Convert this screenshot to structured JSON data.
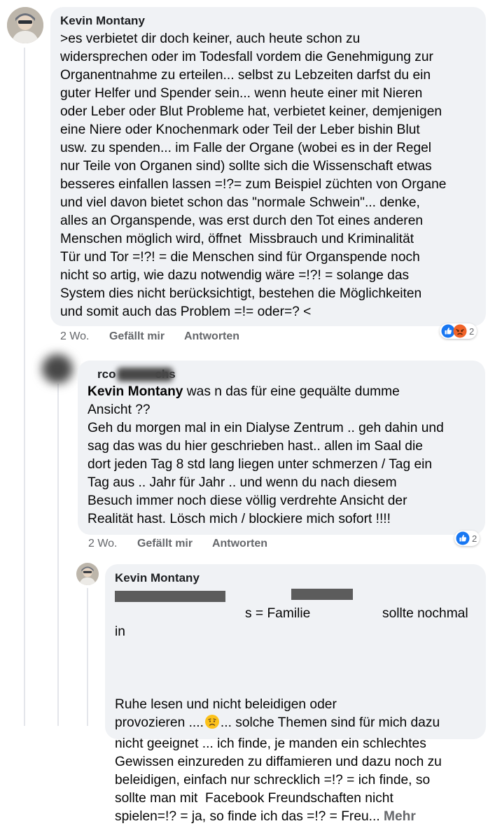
{
  "comment1": {
    "author": "Kevin Montany",
    "lines": [
      ">es verbietet dir doch keiner, auch heute schon zu",
      "widersprechen oder im Todesfall vordem die Genehmigung zur",
      "Organentnahme zu erteilen... selbst zu Lebzeiten darfst du ein",
      "guter Helfer und Spender sein... wenn heute einer mit Nieren",
      "oder Leber oder Blut Probleme hat, verbietet keiner, demjenigen",
      "eine Niere oder Knochenmark oder Teil der Leber bishin Blut",
      "usw. zu spenden... im Falle der Organe (wobei es in der Regel",
      "nur Teile von Organen sind) sollte sich die Wissenschaft etwas",
      "besseres einfallen lassen =!?= zum Beispiel züchten von Organe",
      "und viel davon bietet schon das \"normale Schwein\"... denke,",
      "alles an Organspende, was erst durch den Tot eines anderen",
      "Menschen möglich wird, öffnet  Missbrauch und Kriminalität",
      "Tür und Tor =!?! = die Menschen sind für Organspende noch",
      "nicht so artig, wie dazu notwendig wäre =!?! = solange das",
      "System dies nicht berücksichtigt, bestehen die Möglichkeiten",
      "und somit auch das Problem =!= oder=? <"
    ],
    "time": "2 Wo.",
    "like": "Gefällt mir",
    "reply": "Antworten",
    "reaction_count": "2"
  },
  "comment2": {
    "author_partial": "rco",
    "author_partial2": "chs",
    "mention": "Kevin Montany",
    "first_line_rest": " was n das für eine gequälte dumme",
    "lines": [
      "Ansicht ??",
      "Geh du morgen mal in ein Dialyse Zentrum .. geh dahin und",
      "sag das was du hier geschrieben hast.. allen im Saal die",
      "dort jeden Tag 8 std lang liegen unter schmerzen / Tag ein",
      "Tag aus .. Jahr für Jahr .. und wenn du nach diesem",
      "Besuch immer noch diese völlig verdrehte Ansicht der",
      "Realität hast. Lösch mich / blockiere mich sofort !!!!"
    ],
    "time": "2 Wo.",
    "like": "Gefällt mir",
    "reply": "Antworten",
    "reaction_count": "2"
  },
  "comment3": {
    "author": "Kevin Montany",
    "first_line_a": "s",
    "first_line_b": " = Familie ",
    "first_line_c": " sollte nochmal in",
    "lines": [
      "Ruhe lesen und nicht beleidigen oder",
      "provozieren ....",
      "nicht geeignet ... ich finde, je manden ein schlechtes",
      "Gewissen einzureden zu diffamieren und dazu noch zu",
      "beleidigen, einfach nur schrecklich =!? = ich finde, so",
      "sollte man mit  Facebook Freundschaften nicht",
      "spielen=!? = ja, so finde ich das =!? = Freu..."
    ],
    "line2_rest": "... solche Themen sind für mich dazu",
    "more": "Mehr"
  },
  "colors": {
    "bubble": "#f0f2f5",
    "meta": "#65676b",
    "like_blue": "#1877f2",
    "angry": "#f0642a"
  }
}
